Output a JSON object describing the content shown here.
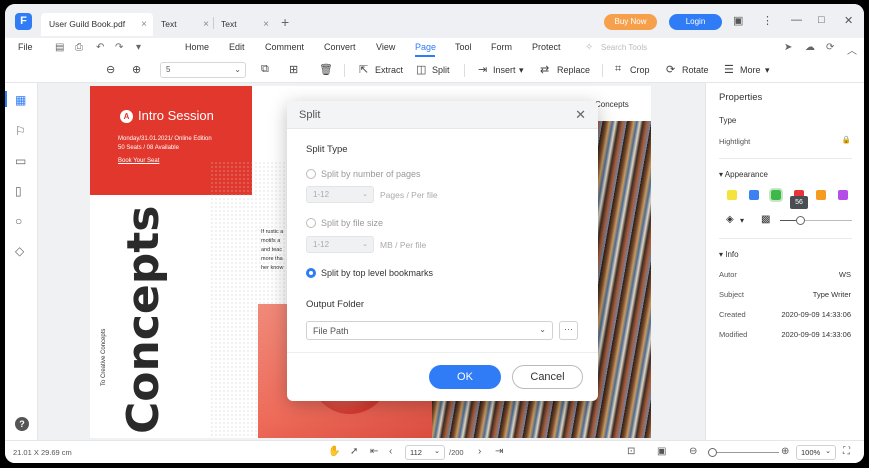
{
  "app": {
    "logo": "F"
  },
  "tabs": [
    {
      "label": "User Guild Book.pdf"
    },
    {
      "label": "Text"
    },
    {
      "label": "Text"
    }
  ],
  "titlebar": {
    "buy_label": "Buy Now",
    "login_label": "Login"
  },
  "menu": {
    "file": "File",
    "items": [
      "Home",
      "Edit",
      "Comment",
      "Convert",
      "View",
      "Page",
      "Tool",
      "Form",
      "Protect"
    ],
    "active": "Page",
    "search_placeholder": "Search Tools"
  },
  "toolbar": {
    "zoom_value": "5",
    "extract": "Extract",
    "split": "Split",
    "insert": "Insert",
    "replace": "Replace",
    "crop": "Crop",
    "rotate": "Rotate",
    "more": "More"
  },
  "document": {
    "badge": "A",
    "session_title": "Intro Session",
    "session_date": "Monday/31.01.2021/ Online Edition",
    "session_seats": "50 Seats / 08 Available",
    "session_link": "Book Your Seat",
    "big_title": "Concepts",
    "small_title": "Concepts",
    "vertical_caption": "To Creative Concepts",
    "body_lines": [
      "If rustic a",
      "motifs a",
      "and teac",
      "more tha",
      "her know"
    ]
  },
  "dialog": {
    "title": "Split",
    "split_type": "Split Type",
    "opt_pages": "Split by number of pages",
    "opt_pages_value": "1-12",
    "opt_pages_unit": "Pages / Per file",
    "opt_size": "Split by file size",
    "opt_size_value": "1-12",
    "opt_size_unit": "MB / Per file",
    "opt_bookmarks": "Split by top level bookmarks",
    "output_folder": "Output Folder",
    "path_value": "File Path",
    "more": "···",
    "ok": "OK",
    "cancel": "Cancel"
  },
  "properties": {
    "title": "Properties",
    "type_label": "Type",
    "type_value": "Hightlight",
    "appearance": "Appearance",
    "swatches": [
      "#f5e33b",
      "#3b82f0",
      "#3fb84a",
      "#e8353a",
      "#f59b1f",
      "#b54ee8"
    ],
    "opacity": "56",
    "info": "Info",
    "rows": [
      {
        "label": "Autor",
        "value": "WS"
      },
      {
        "label": "Subject",
        "value": "Type Writer"
      },
      {
        "label": "Created",
        "value": "2020-09-09 14:33:06"
      },
      {
        "label": "Modified",
        "value": "2020-09-09 14:33:06"
      }
    ]
  },
  "status": {
    "dimensions": "21.01 X 29.69 cm",
    "page_value": "112",
    "page_total": "/200",
    "zoom_value": "100%"
  }
}
